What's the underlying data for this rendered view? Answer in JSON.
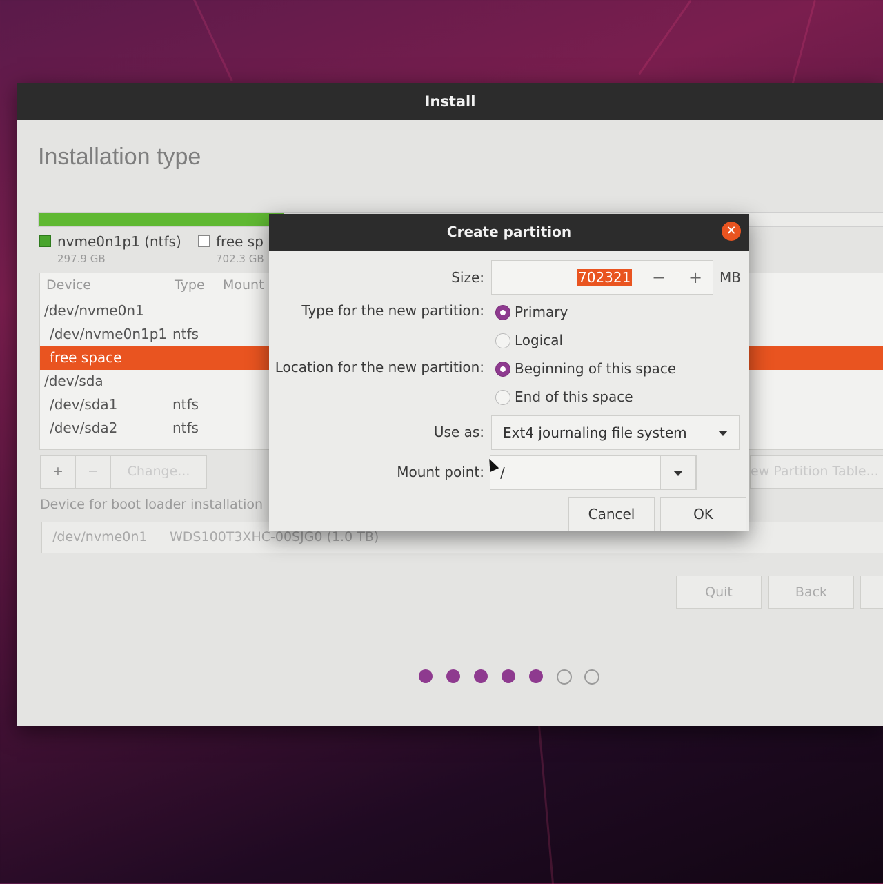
{
  "window": {
    "title": "Install",
    "page_title": "Installation type"
  },
  "partition_bar": {
    "used_fraction": 0.29,
    "items": [
      {
        "label": "nvme0n1p1 (ntfs)",
        "size": "297.9 GB",
        "color": "#4aa52e"
      },
      {
        "label": "free sp",
        "size": "702.3 GB",
        "color": "#ffffff"
      }
    ]
  },
  "table": {
    "headers": {
      "device": "Device",
      "type": "Type",
      "mount": "Mount"
    },
    "rows": [
      {
        "device": "/dev/nvme0n1",
        "type": ""
      },
      {
        "device": "/dev/nvme0n1p1",
        "type": "ntfs"
      },
      {
        "device": "free space",
        "type": ""
      },
      {
        "device": "/dev/sda",
        "type": ""
      },
      {
        "device": "/dev/sda1",
        "type": "ntfs"
      },
      {
        "device": "/dev/sda2",
        "type": "ntfs"
      }
    ]
  },
  "toolbar": {
    "add": "+",
    "remove": "−",
    "change": "Change...",
    "new_table": "ew Partition Table..."
  },
  "bootloader": {
    "label": "Device for boot loader installation",
    "device": "/dev/nvme0n1",
    "model": "WDS100T3XHC-00SJG0 (1.0 TB)"
  },
  "nav": {
    "quit": "Quit",
    "back": "Back"
  },
  "progress_dots": {
    "total": 7,
    "done": 5
  },
  "dialog": {
    "title": "Create partition",
    "size_label": "Size:",
    "size_value": "702321",
    "size_unit": "MB",
    "minus": "−",
    "plus": "+",
    "type_label": "Type for the new partition:",
    "type_primary": "Primary",
    "type_logical": "Logical",
    "type_selected": "Primary",
    "location_label": "Location for the new partition:",
    "location_begin": "Beginning of this space",
    "location_end": "End of this space",
    "location_selected": "Beginning of this space",
    "use_as_label": "Use as:",
    "use_as_value": "Ext4 journaling file system",
    "mount_label": "Mount point:",
    "mount_value": "/",
    "cancel": "Cancel",
    "ok": "OK"
  },
  "colors": {
    "accent": "#e95420",
    "purple": "#8e3a8f",
    "green": "#5fb832"
  }
}
